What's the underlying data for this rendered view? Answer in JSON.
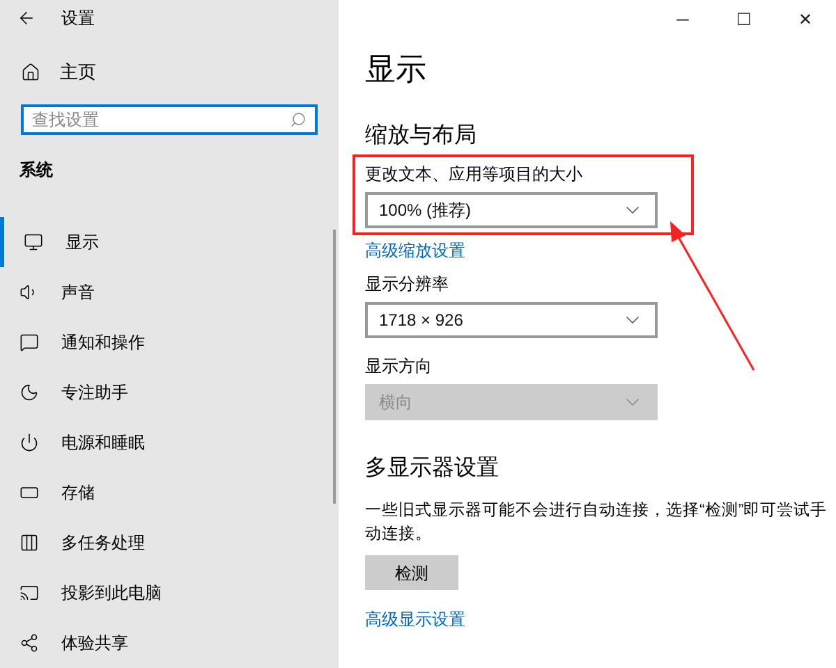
{
  "window": {
    "title": "设置",
    "controls": [
      "─",
      "☐",
      "✕"
    ]
  },
  "sidebar": {
    "home": "主页",
    "search": {
      "placeholder": "查找设置"
    },
    "section": "系统",
    "items": [
      {
        "label": "显示",
        "selected": true
      },
      {
        "label": "声音",
        "selected": false
      },
      {
        "label": "通知和操作",
        "selected": false
      },
      {
        "label": "专注助手",
        "selected": false
      },
      {
        "label": "电源和睡眠",
        "selected": false
      },
      {
        "label": "存储",
        "selected": false
      },
      {
        "label": "多任务处理",
        "selected": false
      },
      {
        "label": "投影到此电脑",
        "selected": false
      },
      {
        "label": "体验共享",
        "selected": false
      }
    ]
  },
  "main": {
    "title": "显示",
    "sections": [
      {
        "heading": "缩放与布局",
        "fields": [
          {
            "label": "更改文本、应用等项目的大小",
            "value": "100% (推荐)",
            "disabled": false,
            "highlighted": true,
            "link": "高级缩放设置"
          },
          {
            "label": "显示分辨率",
            "value": "1718 × 926",
            "disabled": false,
            "highlighted": false
          },
          {
            "label": "显示方向",
            "value": "横向",
            "disabled": true,
            "highlighted": false
          }
        ]
      },
      {
        "heading": "多显示器设置",
        "description": "一些旧式显示器可能不会进行自动连接，选择“检测”即可尝试手动连接。",
        "button": "检测",
        "link": "高级显示设置"
      }
    ]
  }
}
